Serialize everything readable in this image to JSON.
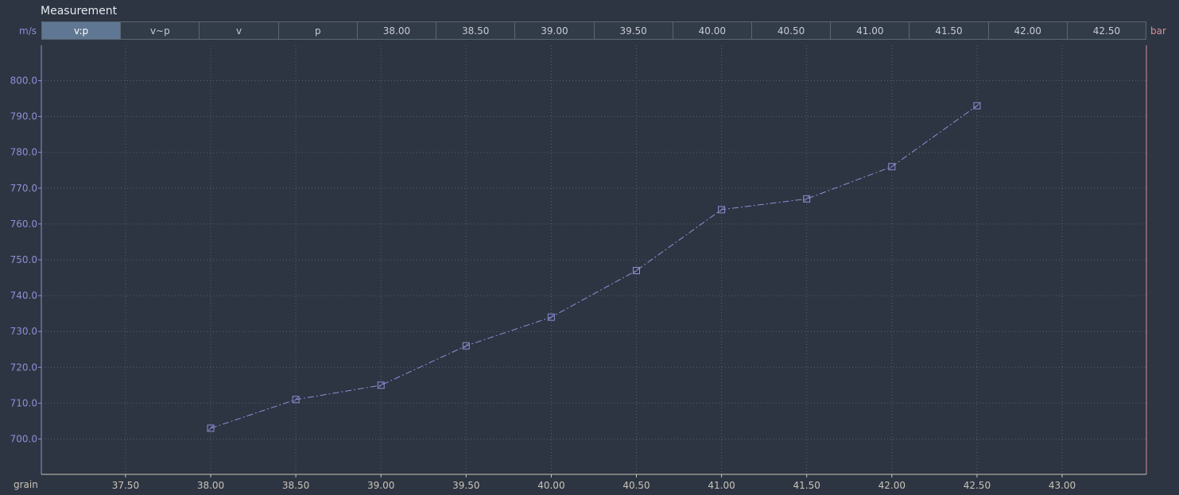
{
  "window": {
    "title": "Measurement",
    "left_unit": "m/s",
    "right_unit": "bar",
    "x_axis_label": "grain"
  },
  "tabs": [
    {
      "label": "v:p",
      "selected": true
    },
    {
      "label": "v~p",
      "selected": false
    },
    {
      "label": "v",
      "selected": false
    },
    {
      "label": "p",
      "selected": false
    },
    {
      "label": "38.00",
      "selected": false
    },
    {
      "label": "38.50",
      "selected": false
    },
    {
      "label": "39.00",
      "selected": false
    },
    {
      "label": "39.50",
      "selected": false
    },
    {
      "label": "40.00",
      "selected": false
    },
    {
      "label": "40.50",
      "selected": false
    },
    {
      "label": "41.00",
      "selected": false
    },
    {
      "label": "41.50",
      "selected": false
    },
    {
      "label": "42.00",
      "selected": false
    },
    {
      "label": "42.50",
      "selected": false
    }
  ],
  "colors": {
    "background": "#2d3542",
    "series": "#8d8fd6",
    "left_axis": "#8d8fd6",
    "right_axis": "#d98e9a",
    "bottom_axis": "#c9c3b8",
    "grid": "#56606e",
    "selected_tab": "#5f7792"
  },
  "chart_data": {
    "type": "line",
    "xlabel": "grain",
    "ylabel": "m/s",
    "y2label": "bar",
    "xlim": [
      37.0,
      43.5
    ],
    "ylim": [
      690,
      810
    ],
    "x_ticks": [
      37.5,
      38.0,
      38.5,
      39.0,
      39.5,
      40.0,
      40.5,
      41.0,
      41.5,
      42.0,
      42.5,
      43.0
    ],
    "y_ticks": [
      700,
      710,
      720,
      730,
      740,
      750,
      760,
      770,
      780,
      790,
      800
    ],
    "grid": true,
    "marker": "square",
    "line_style": "dash-dot",
    "series": [
      {
        "x": [
          38.0,
          38.5,
          39.0,
          39.5,
          40.0,
          40.5,
          41.0,
          41.5,
          42.0,
          42.5
        ],
        "y": [
          703,
          711,
          715,
          726,
          734,
          747,
          764,
          767,
          776,
          793
        ]
      }
    ]
  }
}
